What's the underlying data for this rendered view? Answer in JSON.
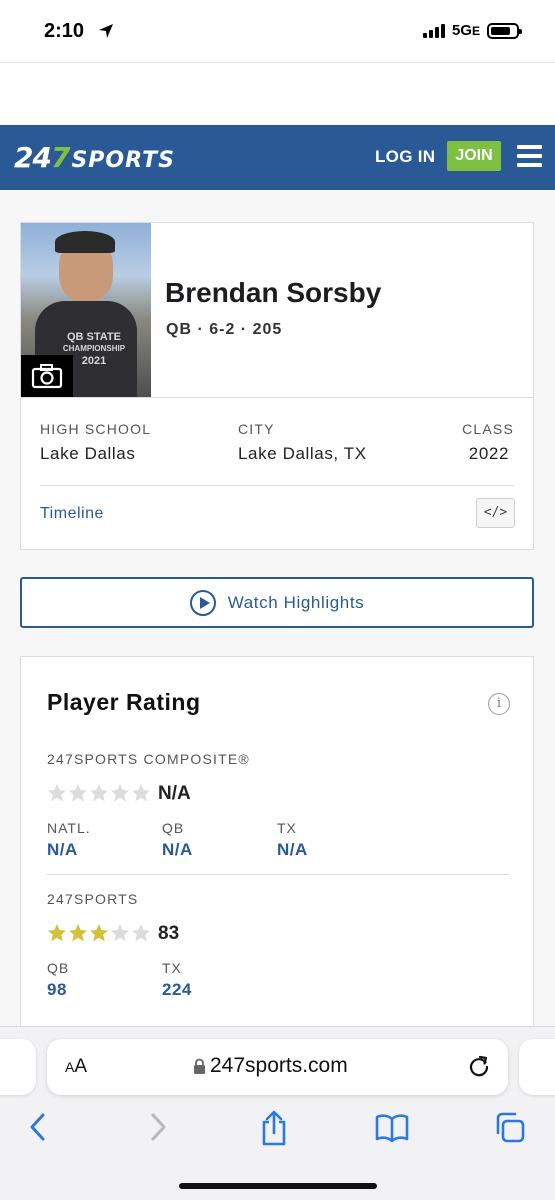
{
  "status_bar": {
    "time": "2:10",
    "network": "5G",
    "network_suffix": "E"
  },
  "header": {
    "logo_num": "24",
    "logo_seven": "7",
    "logo_word": "SPORTS",
    "login_label": "LOG IN",
    "join_label": "JOIN"
  },
  "player": {
    "name": "Brendan Sorsby",
    "meta": "QB · 6-2 · 205",
    "photo_text_line1": "QB STATE",
    "photo_text_line2": "CHAMPIONSHIP",
    "photo_text_line3": "2021",
    "high_school_label": "HIGH SCHOOL",
    "high_school": "Lake Dallas",
    "city_label": "CITY",
    "city": "Lake Dallas, TX",
    "class_label": "CLASS",
    "class_year": "2022",
    "timeline_label": "Timeline",
    "embed_label": "</>"
  },
  "highlights": {
    "label": "Watch Highlights"
  },
  "rating": {
    "title": "Player Rating",
    "info_label": "i",
    "composite": {
      "label": "247SPORTS COMPOSITE®",
      "stars_filled": 0,
      "stars_total": 5,
      "score": "N/A",
      "ranks": [
        {
          "label": "NATL.",
          "value": "N/A"
        },
        {
          "label": "QB",
          "value": "N/A"
        },
        {
          "label": "TX",
          "value": "N/A"
        }
      ]
    },
    "sports247": {
      "label": "247SPORTS",
      "stars_filled": 3,
      "stars_total": 5,
      "score": "83",
      "ranks": [
        {
          "label": "QB",
          "value": "98"
        },
        {
          "label": "TX",
          "value": "224"
        }
      ]
    }
  },
  "browser": {
    "aa_small": "A",
    "aa_large": "A",
    "url": "247sports.com"
  },
  "colors": {
    "brand_blue": "#2a5a96",
    "brand_green": "#7ec142",
    "star_gold": "#d4c03a",
    "star_empty": "#dcdcdc"
  }
}
